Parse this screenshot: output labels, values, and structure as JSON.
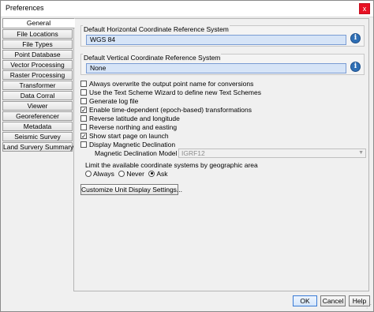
{
  "window": {
    "title": "Preferences",
    "close_label": "x"
  },
  "tabs": [
    "General",
    "File Locations",
    "File Types",
    "Point Database",
    "Vector Processing",
    "Raster Processing",
    "Transformer",
    "Data Corral",
    "Viewer",
    "Georeferencer",
    "Metadata",
    "Seismic Survey",
    "Land Survery Summary"
  ],
  "active_tab": "General",
  "horizontal": {
    "label": "Default Horizontal Coordinate Reference System",
    "value": "WGS 84"
  },
  "vertical": {
    "label": "Default Vertical Coordinate Reference System",
    "value": "None"
  },
  "checkboxes": [
    {
      "label": "Always overwrite the output point name for conversions",
      "checked": false
    },
    {
      "label": "Use the Text Scheme Wizard to define new Text Schemes",
      "checked": false
    },
    {
      "label": "Generate log file",
      "checked": false
    },
    {
      "label": "Enable time-dependent (epoch-based) transformations",
      "checked": true
    },
    {
      "label": "Reverse latitude and longitude",
      "checked": false
    },
    {
      "label": "Reverse northing and easting",
      "checked": false
    },
    {
      "label": "Show start page on launch",
      "checked": true
    },
    {
      "label": "Display Magnetic Declination",
      "checked": false
    }
  ],
  "declination": {
    "label": "Magnetic Declination Model",
    "value": "IGRF12"
  },
  "limit": {
    "title": "Limit the available coordinate systems by geographic area",
    "options": [
      "Always",
      "Never",
      "Ask"
    ],
    "selected": "Ask"
  },
  "buttons": {
    "customize": "Customize Unit Display Settings...",
    "ok": "OK",
    "cancel": "Cancel",
    "help": "Help"
  },
  "icons": {
    "info": "info-icon",
    "close": "close-icon",
    "dropdown": "chevron-down-icon",
    "grip": "resize-grip-icon"
  },
  "colors": {
    "field_bg": "#d6e4f7",
    "close_bg": "#e81123",
    "info_bg": "#2f6fb5"
  }
}
